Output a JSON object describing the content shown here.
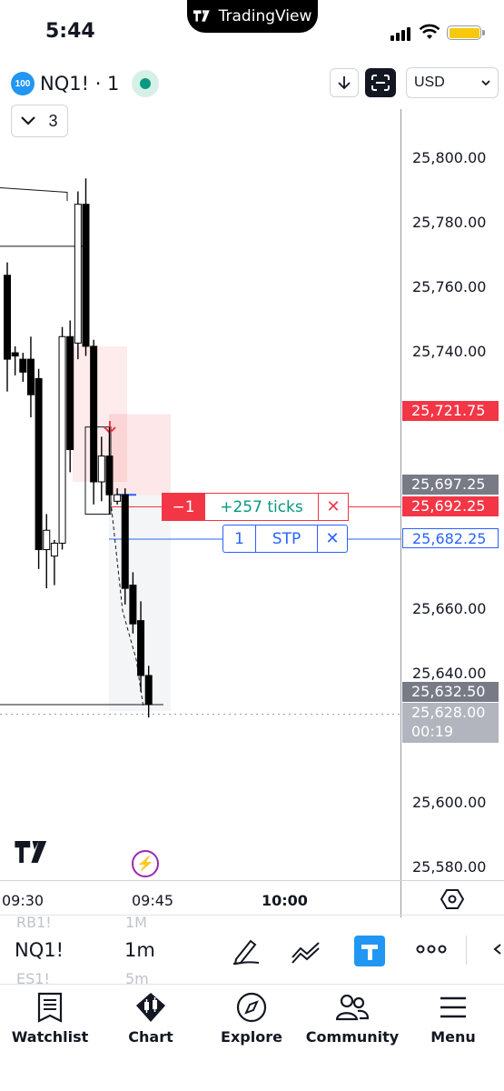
{
  "status_bar": {
    "time": "5:44",
    "island_brand": "TradingView"
  },
  "chart_header": {
    "badge": "100",
    "symbol_title": "NQ1! · 1",
    "indicator_count": "3",
    "currency": "USD"
  },
  "price_axis": {
    "ticks": [
      "25,800.00",
      "25,780.00",
      "25,760.00",
      "25,740.00",
      "25,660.00",
      "25,640.00",
      "25,600.00",
      "25,580.00"
    ],
    "tags": {
      "alert_price": "25,721.75",
      "prev_price": "25,697.25",
      "position_price": "25,692.25",
      "stop_price": "25,682.25",
      "high_marker": "25,632.50",
      "last_price": "25,628.00",
      "countdown": "00:19"
    }
  },
  "position_line": {
    "quantity": "−1",
    "pnl": "+257 ticks",
    "close": "✕"
  },
  "order_line": {
    "quantity": "1",
    "type": "STP",
    "close": "✕"
  },
  "time_axis": {
    "labels": [
      "09:30",
      "09:45",
      "10:00"
    ]
  },
  "toolbar": {
    "symbol": "NQ1!",
    "interval": "1m",
    "ghost_prev_symbol": "RB1!",
    "ghost_next_symbol": "ES1!",
    "ghost_prev_interval": "1M",
    "ghost_next_interval": "5m"
  },
  "tabbar": {
    "items": [
      {
        "label": "Watchlist",
        "icon": "watchlist-icon"
      },
      {
        "label": "Chart",
        "icon": "chart-icon"
      },
      {
        "label": "Explore",
        "icon": "compass-icon"
      },
      {
        "label": "Community",
        "icon": "people-icon"
      },
      {
        "label": "Menu",
        "icon": "hamburger-icon"
      }
    ]
  },
  "colors": {
    "up": "#ffffff",
    "down": "#000000",
    "sell": "#f23645",
    "stop": "#2962ff",
    "profit": "#089981",
    "accent": "#2196f3"
  },
  "chart_data": {
    "type": "candlestick",
    "price_range": [
      25570,
      25815
    ],
    "candles": [
      {
        "o": 25764,
        "h": 25768,
        "l": 25728,
        "c": 25738
      },
      {
        "o": 25740,
        "h": 25742,
        "l": 25733,
        "c": 25739
      },
      {
        "o": 25738,
        "h": 25740,
        "l": 25731,
        "c": 25734
      },
      {
        "o": 25738,
        "h": 25745,
        "l": 25720,
        "c": 25727
      },
      {
        "o": 25732,
        "h": 25735,
        "l": 25673,
        "c": 25679
      },
      {
        "o": 25679,
        "h": 25690,
        "l": 25667,
        "c": 25685
      },
      {
        "o": 25677,
        "h": 25682,
        "l": 25668,
        "c": 25681
      },
      {
        "o": 25681,
        "h": 25748,
        "l": 25679,
        "c": 25745
      },
      {
        "o": 25745,
        "h": 25750,
        "l": 25703,
        "c": 25710
      },
      {
        "o": 25743,
        "h": 25790,
        "l": 25738,
        "c": 25786
      },
      {
        "o": 25786,
        "h": 25794,
        "l": 25739,
        "c": 25742
      },
      {
        "o": 25742,
        "h": 25744,
        "l": 25693,
        "c": 25700
      },
      {
        "o": 25700,
        "h": 25714,
        "l": 25694,
        "c": 25708
      },
      {
        "o": 25708,
        "h": 25717,
        "l": 25690,
        "c": 25696
      },
      {
        "o": 25694,
        "h": 25698,
        "l": 25693,
        "c": 25696
      },
      {
        "o": 25696,
        "h": 25698,
        "l": 25662,
        "c": 25667
      },
      {
        "o": 25668,
        "h": 25672,
        "l": 25653,
        "c": 25656
      },
      {
        "o": 25657,
        "h": 25663,
        "l": 25635,
        "c": 25640
      },
      {
        "o": 25640,
        "h": 25643,
        "l": 25627,
        "c": 25631
      }
    ]
  }
}
